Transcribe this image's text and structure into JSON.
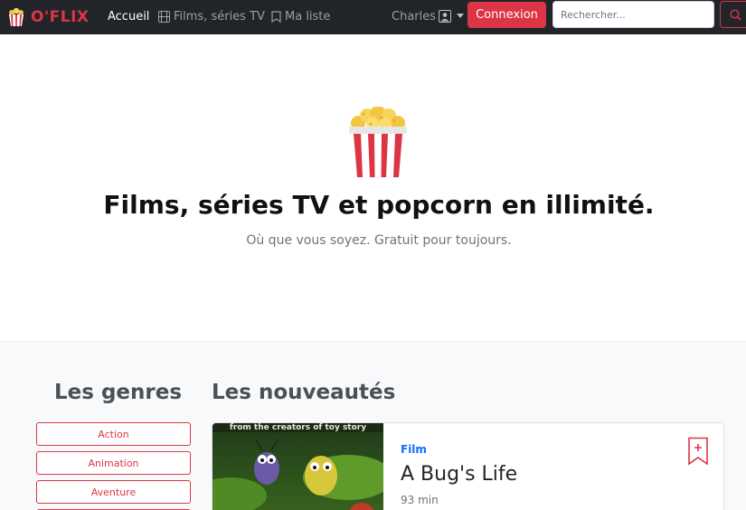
{
  "navbar": {
    "brand": "O'FLIX",
    "links": [
      {
        "label": "Accueil",
        "icon": "none",
        "active": true
      },
      {
        "label": "Films, séries TV",
        "icon": "film-icon",
        "active": false
      },
      {
        "label": "Ma liste",
        "icon": "bookmark-icon",
        "active": false
      }
    ],
    "user": {
      "label": "Charles",
      "icon": "person-square-icon"
    },
    "login_button": "Connexion",
    "search": {
      "placeholder": "Rechercher...",
      "value": ""
    }
  },
  "hero": {
    "icon": "popcorn-icon",
    "title": "Films, séries TV et popcorn en illimité.",
    "lead": "Où que vous soyez. Gratuit pour toujours."
  },
  "genres": {
    "title": "Les genres",
    "items": [
      "Action",
      "Animation",
      "Aventure"
    ]
  },
  "latest": {
    "title": "Les nouveautés",
    "items": [
      {
        "type": "Film",
        "title": "A Bug's Life",
        "duration": "93 min",
        "poster_caption": "from the creators of toy story"
      }
    ]
  },
  "colors": {
    "accent": "#dc3545",
    "navbar": "#212529",
    "link_blue": "#0d6efd"
  }
}
